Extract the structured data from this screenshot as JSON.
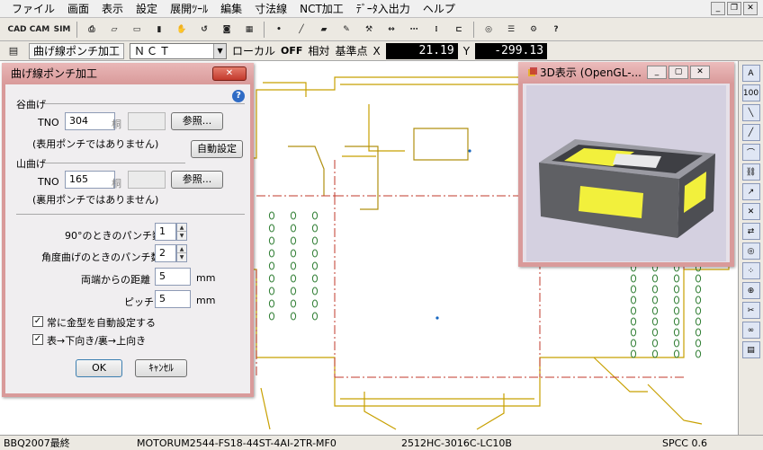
{
  "menu": [
    "ファイル",
    "画面",
    "表示",
    "設定",
    "展開ﾂｰﾙ",
    "編集",
    "寸法線",
    "NCT加工",
    "ﾃﾞｰﾀ入出力",
    "ヘルプ"
  ],
  "toolbar_icons": [
    {
      "name": "cad-import-icon",
      "label": "CAD"
    },
    {
      "name": "cam-icon",
      "label": "CAM"
    },
    {
      "name": "sim-icon",
      "label": "SIM"
    },
    {
      "name": "print-icon",
      "label": "⎙"
    },
    {
      "name": "eraser-icon",
      "label": "▱"
    },
    {
      "name": "rectangle-icon",
      "label": "▭"
    },
    {
      "name": "fill-icon",
      "label": "▮"
    },
    {
      "name": "hand-icon",
      "label": "✋"
    },
    {
      "name": "rotate-icon",
      "label": "↺"
    },
    {
      "name": "punch-icon",
      "label": "◙"
    },
    {
      "name": "pattern-icon",
      "label": "▦"
    },
    {
      "name": "point-icon",
      "label": "•"
    },
    {
      "name": "line-icon",
      "label": "╱"
    },
    {
      "name": "color-icon",
      "label": "▰"
    },
    {
      "name": "pen-icon",
      "label": "✎"
    },
    {
      "name": "tool-icon",
      "label": "⚒"
    },
    {
      "name": "dimension-icon",
      "label": "↔"
    },
    {
      "name": "grid-icon",
      "label": "⋯"
    },
    {
      "name": "array-icon",
      "label": "⁞"
    },
    {
      "name": "frame-icon",
      "label": "⊏"
    },
    {
      "name": "node-icon",
      "label": "◎"
    },
    {
      "name": "layer-icon",
      "label": "☰"
    },
    {
      "name": "settings-icon",
      "label": "⚙"
    },
    {
      "name": "help-icon",
      "label": "?"
    }
  ],
  "toolbar2": {
    "mode_button": "曲げ線ポンチ加工",
    "nct_select": "ＮＣＴ",
    "local_label": "ローカル",
    "off_label": "OFF",
    "relative_label": "相対",
    "base_point_label": "基準点",
    "x_label": "X",
    "x_value": "21.19",
    "y_label": "Y",
    "y_value": "-299.13"
  },
  "dialog": {
    "title": "曲げ線ポンチ加工",
    "valley_heading": "谷曲げ",
    "tno_label": "TNO",
    "valley_tno": "304",
    "unit_label": "桐",
    "ref_button": "参照...",
    "valley_note": "(表用ポンチではありません)",
    "auto_button": "自動設定",
    "mountain_heading": "山曲げ",
    "mountain_tno": "165",
    "mountain_note": "(裏用ポンチではありません)",
    "punch90_label": "90°のときのパンチ数",
    "punch90_value": "1",
    "angle_label": "角度曲げのときのパンチ数",
    "angle_value": "2",
    "edge_dist_label": "両端からの距離",
    "edge_dist_value": "5",
    "pitch_label": "ピッチ",
    "pitch_value": "5",
    "mm": "mm",
    "check1": "常に金型を自動設定する",
    "check2": "表→下向き/裏→上向き",
    "ok": "OK",
    "cancel": "ｷｬﾝｾﾙ"
  },
  "view3d": {
    "title": "3D表示 (OpenGL-...",
    "colors": {
      "body": "#5f6064",
      "top": "#9a9aa2",
      "accent": "#f2f03c",
      "bg": "#d4d0e0"
    }
  },
  "right_icons": [
    "layer-a-icon",
    "layer-100-icon",
    "line-icon",
    "diag-line-icon",
    "bend-icon",
    "link-icon",
    "arrow-icon",
    "close-x-icon",
    "swap-icon",
    "target-icon",
    "color-dots-icon",
    "node-icon",
    "cut-icon",
    "chain-icon",
    "doc-icon"
  ],
  "status": {
    "left": "BBQ2007最終",
    "part": "MOTORUM2544-FS18-44ST-4AI-2TR-MF0",
    "code": "2512HC-3016C-LC10B",
    "material": "SPCC 0.6"
  },
  "colors": {
    "outline": "#c8a000",
    "bend": "#c0392b",
    "punch": "#2e7d32"
  }
}
